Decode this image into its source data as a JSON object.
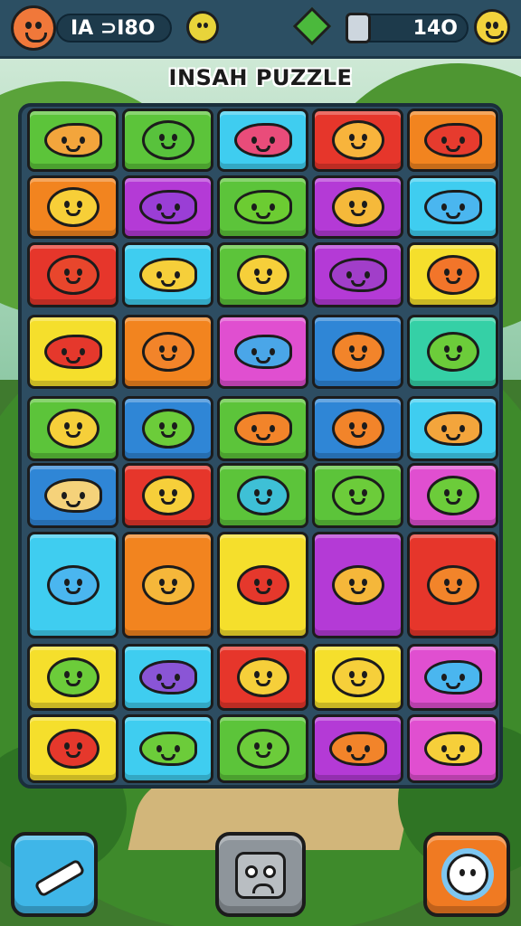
{
  "hud": {
    "score": "IA ⊃I8O",
    "coins": "14O"
  },
  "title": "INSAH PUZZLE",
  "colors": {
    "green": "#5cc43a",
    "cyan": "#3fcdf0",
    "red": "#e6362b",
    "orange": "#f2841f",
    "purple": "#b43ad6",
    "yellow": "#f5df2c",
    "blue": "#2f86d6",
    "teal": "#35d0a6",
    "magenta": "#e04fd0"
  },
  "board": {
    "rows": [
      [
        {
          "c": "green",
          "f": "#f3a53c",
          "k": "fish"
        },
        {
          "c": "green",
          "f": "#58c23c",
          "k": "face"
        },
        {
          "c": "cyan",
          "f": "#e94c7a",
          "k": "fish"
        },
        {
          "c": "red",
          "f": "#f8b43c",
          "k": "face"
        },
        {
          "c": "orange",
          "f": "#e63b2e",
          "k": "fish"
        }
      ],
      [
        {
          "c": "orange",
          "f": "#f7cf38",
          "k": "face"
        },
        {
          "c": "purple",
          "f": "#9a3ed6",
          "k": "fish"
        },
        {
          "c": "green",
          "f": "#6ccc32",
          "k": "fish"
        },
        {
          "c": "purple",
          "f": "#f5b93a",
          "k": "face"
        },
        {
          "c": "cyan",
          "f": "#4ab6ef",
          "k": "fish"
        }
      ],
      [
        {
          "c": "red",
          "f": "#e8462c",
          "k": "face"
        },
        {
          "c": "cyan",
          "f": "#f6cf3a",
          "k": "fish"
        },
        {
          "c": "green",
          "f": "#f6cf3a",
          "k": "face"
        },
        {
          "c": "purple",
          "f": "#a13ec9",
          "k": "fish"
        },
        {
          "c": "yellow",
          "f": "#f2752a",
          "k": "face"
        }
      ],
      [
        {
          "c": "yellow",
          "f": "#e5382c",
          "k": "fish"
        },
        {
          "c": "orange",
          "f": "#f2842a",
          "k": "face"
        },
        {
          "c": "magenta",
          "f": "#4aa6e8",
          "k": "fish"
        },
        {
          "c": "blue",
          "f": "#f2842a",
          "k": "face"
        },
        {
          "c": "teal",
          "f": "#6ccc3a",
          "k": "face"
        }
      ],
      [
        {
          "c": "green",
          "f": "#f6cf3a",
          "k": "face"
        },
        {
          "c": "blue",
          "f": "#6ccc3a",
          "k": "face"
        },
        {
          "c": "green",
          "f": "#f2842a",
          "k": "fish"
        },
        {
          "c": "blue",
          "f": "#f2842a",
          "k": "face"
        },
        {
          "c": "cyan",
          "f": "#f3a53c",
          "k": "fish"
        }
      ],
      [
        {
          "c": "blue",
          "f": "#f5d27a",
          "k": "fish"
        },
        {
          "c": "red",
          "f": "#f6cf3a",
          "k": "face"
        },
        {
          "c": "green",
          "f": "#3ec0d6",
          "k": "face"
        },
        {
          "c": "green",
          "f": "#6ccc3a",
          "k": "face"
        },
        {
          "c": "magenta",
          "f": "#6ccc3a",
          "k": "face"
        }
      ],
      [
        {
          "c": "cyan",
          "f": "#4ab6ef",
          "k": "face"
        },
        {
          "c": "orange",
          "f": "#f5b73a",
          "k": "face"
        },
        {
          "c": "yellow",
          "f": "#e5382c",
          "k": "face"
        },
        {
          "c": "purple",
          "f": "#f5b73a",
          "k": "face"
        },
        {
          "c": "red",
          "f": "#f2842a",
          "k": "face"
        }
      ],
      [
        {
          "c": "yellow",
          "f": "#6ccc3a",
          "k": "face"
        },
        {
          "c": "cyan",
          "f": "#8a55d6",
          "k": "fish"
        },
        {
          "c": "red",
          "f": "#f6cf3a",
          "k": "face"
        },
        {
          "c": "yellow",
          "f": "#f6cf3a",
          "k": "face"
        },
        {
          "c": "magenta",
          "f": "#4ab6ef",
          "k": "fish"
        }
      ],
      [
        {
          "c": "yellow",
          "f": "#e5382c",
          "k": "face"
        },
        {
          "c": "cyan",
          "f": "#6ccc3a",
          "k": "fish"
        },
        {
          "c": "green",
          "f": "#6ccc3a",
          "k": "face"
        },
        {
          "c": "purple",
          "f": "#f2842a",
          "k": "fish"
        },
        {
          "c": "magenta",
          "f": "#f6cf3a",
          "k": "fish"
        }
      ]
    ]
  }
}
